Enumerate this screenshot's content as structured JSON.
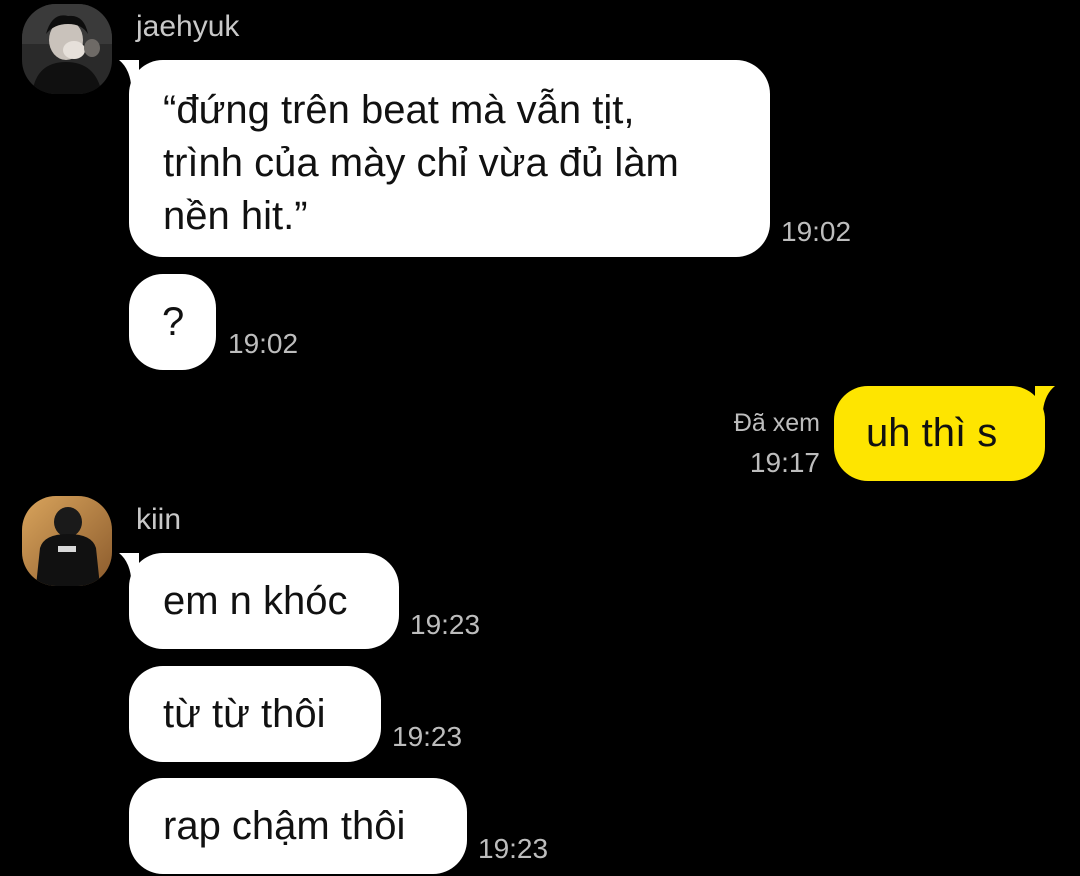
{
  "chat": {
    "messages": [
      {
        "sender": "jaehyuk",
        "avatar_icon": "profile-photo-icon",
        "text": "“đứng trên beat mà vẫn tịt,\ntrình của mày chỉ vừa đủ làm\nnền hit.”",
        "time": "19:02"
      },
      {
        "text": "?",
        "time": "19:02"
      },
      {
        "outgoing": true,
        "text": "uh thì s",
        "read_status": "Đã xem",
        "time": "19:17"
      },
      {
        "sender": "kiin",
        "avatar_icon": "profile-photo-icon",
        "text": "em n khóc",
        "time": "19:23"
      },
      {
        "text": "từ từ thôi",
        "time": "19:23"
      },
      {
        "text": "rap chậm thôi",
        "time": "19:23"
      }
    ]
  },
  "colors": {
    "background": "#000000",
    "incoming_bubble": "#ffffff",
    "outgoing_bubble": "#fee500",
    "meta_text": "#bdbdbd"
  }
}
